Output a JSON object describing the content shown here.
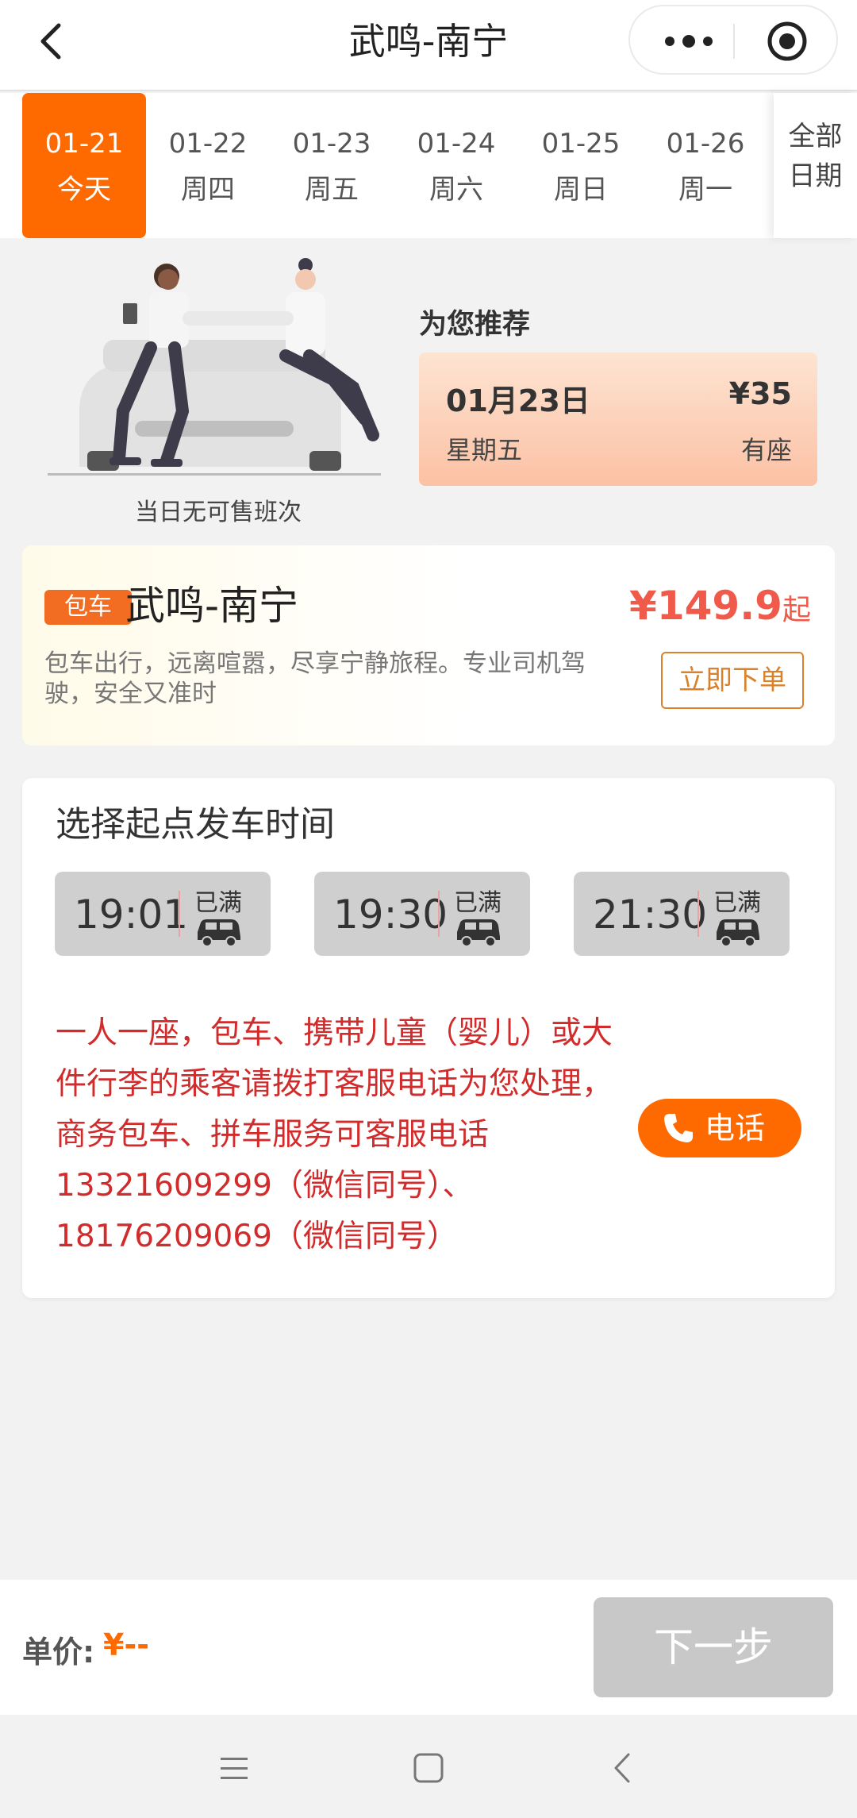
{
  "header": {
    "title": "武鸣-南宁"
  },
  "dates": [
    {
      "date": "01-21",
      "weekday": "今天",
      "active": true
    },
    {
      "date": "01-22",
      "weekday": "周四",
      "active": false
    },
    {
      "date": "01-23",
      "weekday": "周五",
      "active": false
    },
    {
      "date": "01-24",
      "weekday": "周六",
      "active": false
    },
    {
      "date": "01-25",
      "weekday": "周日",
      "active": false
    },
    {
      "date": "01-26",
      "weekday": "周一",
      "active": false
    }
  ],
  "all_dates": {
    "line1": "全部",
    "line2": "日期"
  },
  "empty_state": {
    "text": "当日无可售班次"
  },
  "recommend": {
    "title": "为您推荐",
    "date": "01月23日",
    "price": "¥35",
    "weekday": "星期五",
    "seat_status": "有座"
  },
  "charter": {
    "badge": "包车",
    "route": "武鸣-南宁",
    "price": "¥149.9",
    "price_suffix": "起",
    "description": "包车出行，远离喧嚣，尽享宁静旅程。专业司机驾驶，安全又准时",
    "order_button": "立即下单"
  },
  "departure": {
    "title": "选择起点发车时间",
    "slots": [
      {
        "time": "19:01",
        "status": "已满"
      },
      {
        "time": "19:30",
        "status": "已满"
      },
      {
        "time": "21:30",
        "status": "已满"
      }
    ],
    "notice": "一人一座，包车、携带儿童（婴儿）或大件行李的乘客请拨打客服电话为您处理，商务包车、拼车服务可客服电话13321609299（微信同号）、18176209069（微信同号）",
    "call_button": "电话"
  },
  "footer": {
    "unit_price_label": "单价:",
    "unit_price_value": "¥--",
    "next_button": "下一步"
  },
  "colors": {
    "accent": "#ff6a00",
    "notice_red": "#d22b2b",
    "price_red": "#f05a4a"
  }
}
